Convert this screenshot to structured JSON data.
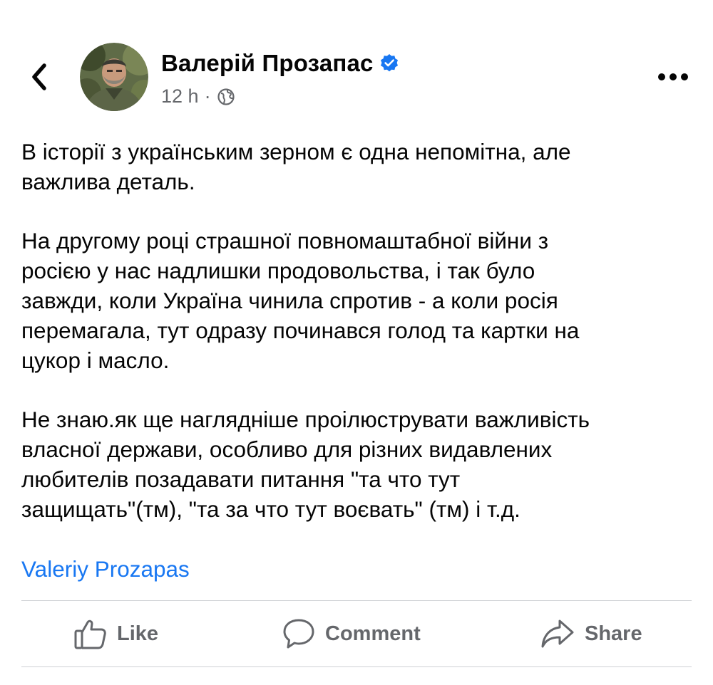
{
  "author": {
    "name": "Валерій Прозапас",
    "verified": true
  },
  "meta": {
    "time": "12 h",
    "separator": "·",
    "audience_icon": "globe-icon"
  },
  "post": {
    "paragraphs": [
      "В історії з українським зерном є одна непомітна, але\nважлива деталь.",
      "На другому році страшної повномаштабної війни з\nросією у нас надлишки продовольства, і так було\nзавжди, коли Україна чинила спротив - а коли росія\nперемагала, тут одразу починався голод та картки на\nцукор і масло.",
      "Не знаю.як ще наглядніше проілюструвати важливість\nвласної  держави, особливо для різних видавлених\nлюбителів позадавати питання \"та что тут\nзащищать\"(тм), \"та за что тут воєвать\" (тм) і т.д."
    ],
    "page_link": "Valeriy Prozapas"
  },
  "actions": {
    "like": "Like",
    "comment": "Comment",
    "share": "Share"
  },
  "icons": {
    "back": "chevron-left-icon",
    "more": "more-horizontal-icon",
    "verified": "verified-badge-icon",
    "like": "thumbs-up-icon",
    "comment": "comment-bubble-icon",
    "share": "share-arrow-icon"
  },
  "colors": {
    "text": "#050505",
    "secondary": "#65676b",
    "link": "#1877f2",
    "verified": "#1877f2",
    "divider": "#ced0d4"
  }
}
